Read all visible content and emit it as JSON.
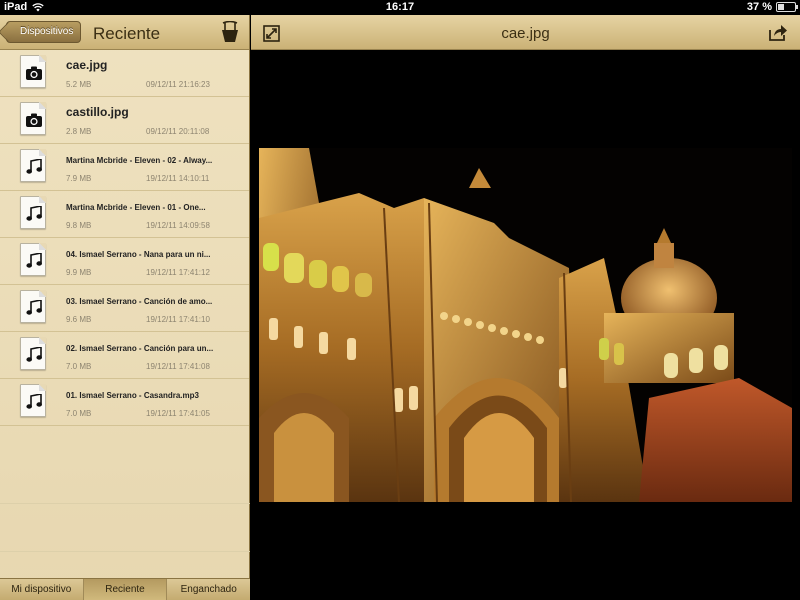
{
  "status": {
    "device": "iPad",
    "time": "16:17",
    "battery": "37 %",
    "battery_level": 0.37
  },
  "left_panel": {
    "back_label": "Dispositivos",
    "title": "Reciente",
    "files": [
      {
        "name": "cae.jpg",
        "size": "5.2 MB",
        "date": "09/12/11 21:16:23",
        "icon": "camera-icon"
      },
      {
        "name": "castillo.jpg",
        "size": "2.8 MB",
        "date": "09/12/11 20:11:08",
        "icon": "camera-icon"
      },
      {
        "name": "Martina Mcbride - Eleven - 02 - Alway...",
        "size": "7.9 MB",
        "date": "19/12/11 14:10:11",
        "icon": "music-note-icon"
      },
      {
        "name": "Martina Mcbride - Eleven - 01 - One...",
        "size": "9.8 MB",
        "date": "19/12/11 14:09:58",
        "icon": "music-note-icon"
      },
      {
        "name": "04. Ismael Serrano - Nana para un ni...",
        "size": "9.9 MB",
        "date": "19/12/11 17:41:12",
        "icon": "music-note-icon"
      },
      {
        "name": "03. Ismael Serrano - Canción de amo...",
        "size": "9.6 MB",
        "date": "19/12/11 17:41:10",
        "icon": "music-note-icon"
      },
      {
        "name": "02. Ismael Serrano - Canción para un...",
        "size": "7.0 MB",
        "date": "19/12/11 17:41:08",
        "icon": "music-note-icon"
      },
      {
        "name": "01. Ismael Serrano - Casandra.mp3",
        "size": "7.0 MB",
        "date": "19/12/11 17:41:05",
        "icon": "music-note-icon"
      }
    ],
    "tabs": [
      "Mi dispositivo",
      "Reciente",
      "Enganchado"
    ],
    "active_tab": "Reciente"
  },
  "right_panel": {
    "title": "cae.jpg"
  },
  "colors": {
    "accent": "#cbb276",
    "panel": "#efe2c0"
  }
}
